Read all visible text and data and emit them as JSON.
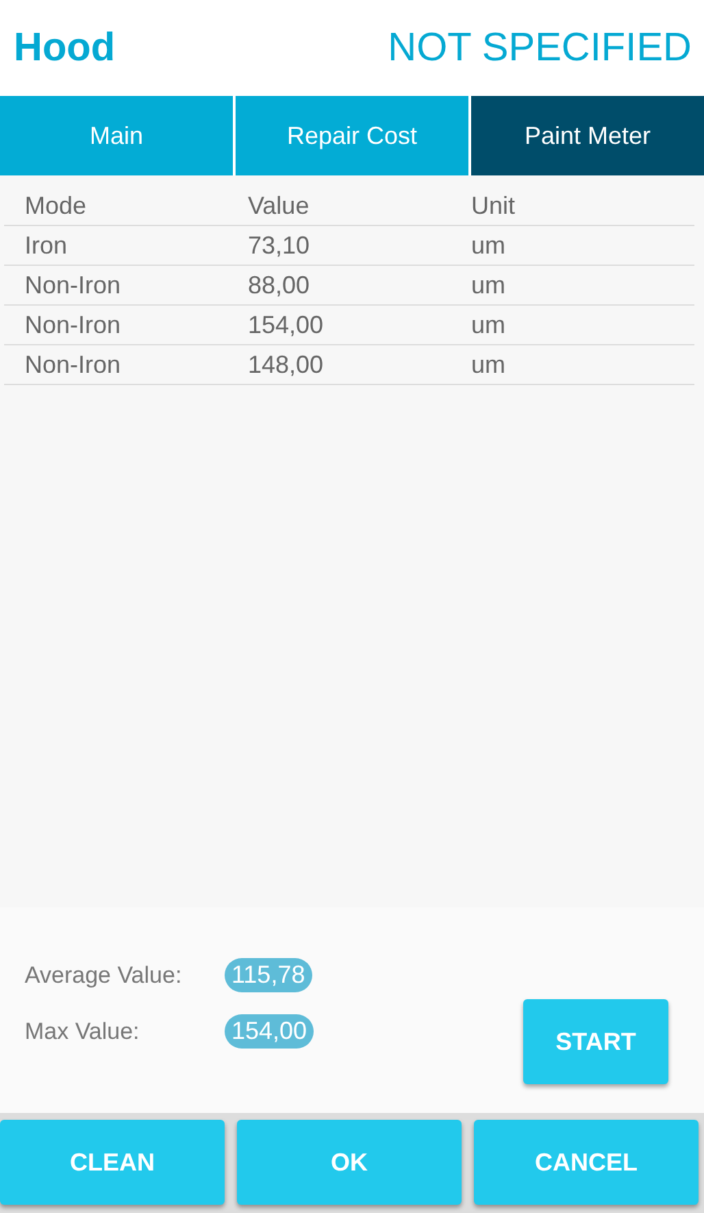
{
  "header": {
    "title": "Hood",
    "status": "NOT SPECIFIED"
  },
  "tabs": [
    {
      "label": "Main",
      "selected": false
    },
    {
      "label": "Repair Cost",
      "selected": false
    },
    {
      "label": "Paint Meter",
      "selected": true
    }
  ],
  "table": {
    "columns": [
      "Mode",
      "Value",
      "Unit"
    ],
    "rows": [
      [
        "Iron",
        "73,10",
        "um"
      ],
      [
        "Non-Iron",
        "88,00",
        "um"
      ],
      [
        "Non-Iron",
        "154,00",
        "um"
      ],
      [
        "Non-Iron",
        "148,00",
        "um"
      ]
    ]
  },
  "summary": [
    {
      "label": "Average Value:",
      "value": "115,78"
    },
    {
      "label": "Max Value:",
      "value": "154,00"
    }
  ],
  "start_button": "START",
  "buttons": [
    "CLEAN",
    "OK",
    "CANCEL"
  ]
}
